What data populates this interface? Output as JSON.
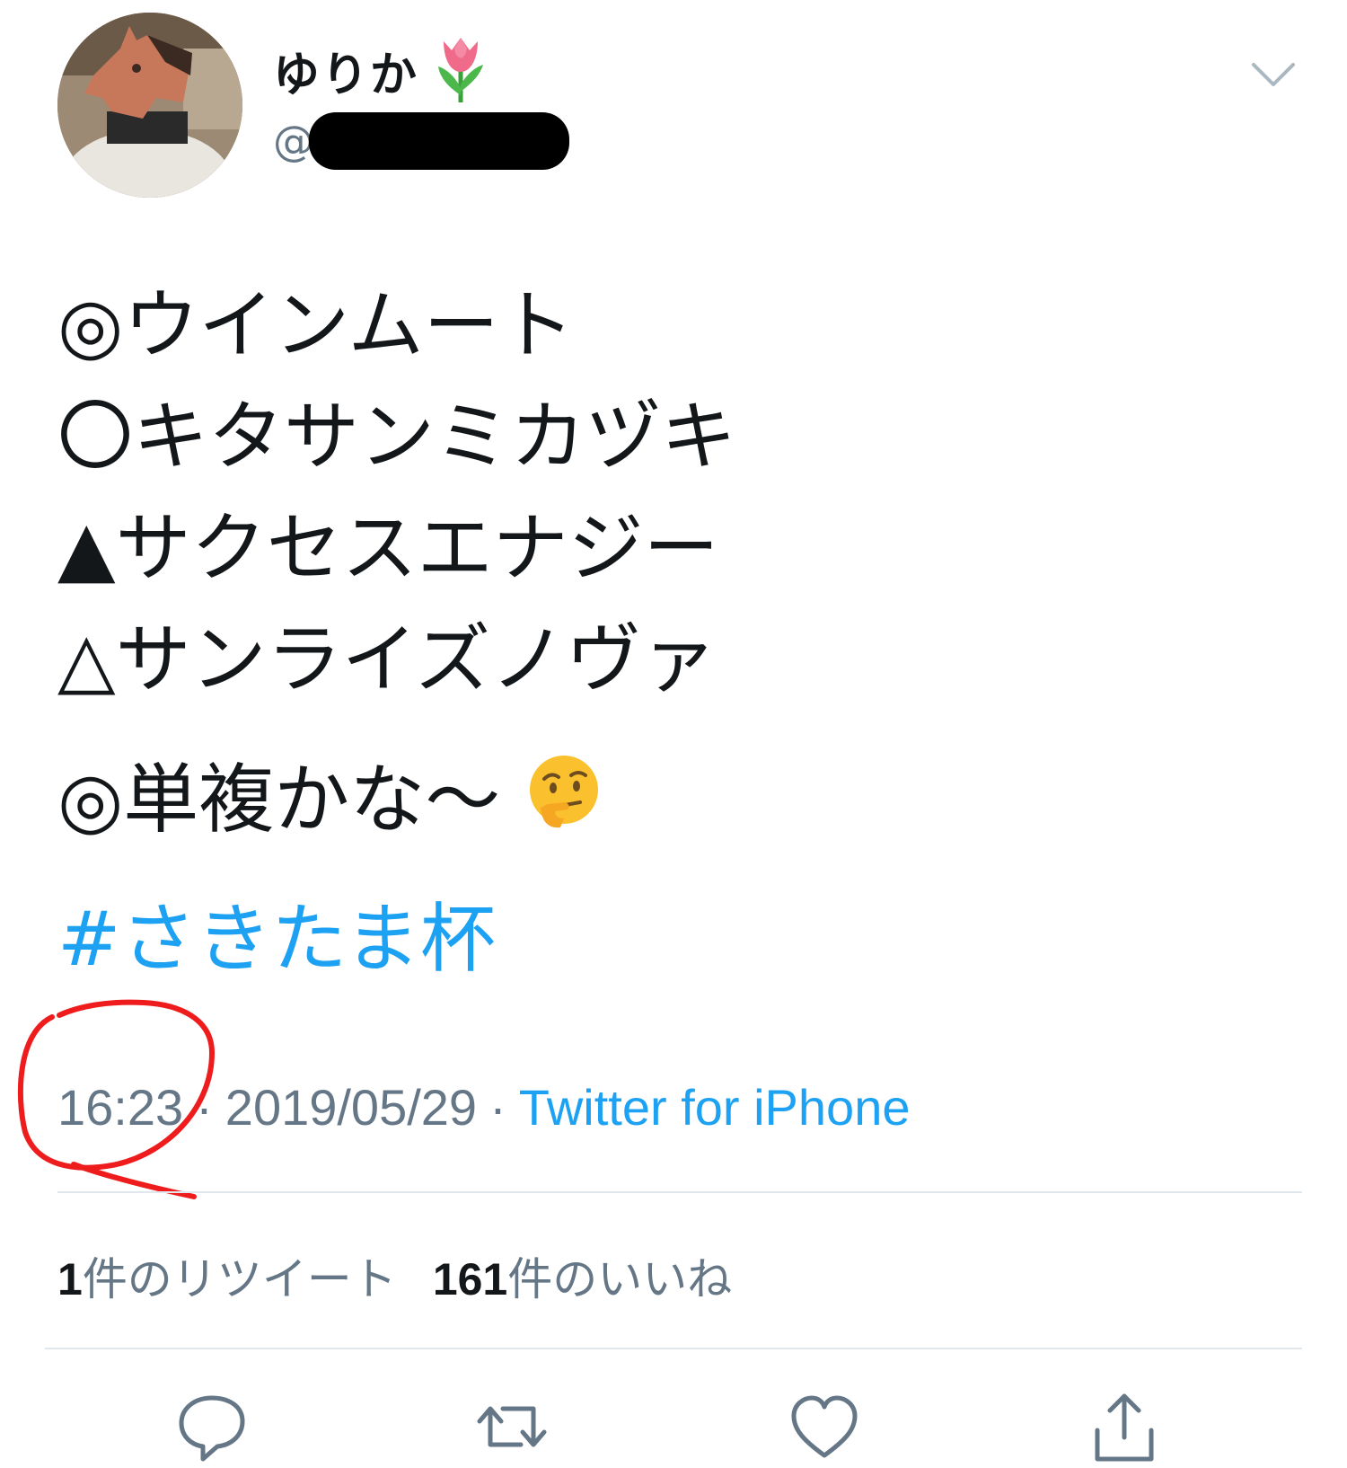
{
  "user": {
    "display_name": "ゆりか",
    "name_emoji_icon": "tulip-icon",
    "handle_prefix": "@",
    "handle_redacted": true,
    "avatar_icon": "user-avatar-horse-mask"
  },
  "tweet": {
    "lines": [
      "◎ウインムート",
      "〇キタサンミカヅキ",
      "▲サクセスエナジー",
      "△サンライズノヴァ"
    ],
    "closing_line": "◎単複かな〜",
    "closing_emoji_icon": "thinking-face-icon",
    "hashtag": "#さきたま杯"
  },
  "meta": {
    "time": "16:23",
    "separator": "·",
    "date": "2019/05/29",
    "source": "Twitter for iPhone"
  },
  "stats": {
    "retweet_count": "1",
    "retweet_label": "件のリツイート",
    "like_count": "161",
    "like_label": "件のいいね"
  },
  "actions": [
    "reply-icon",
    "retweet-icon",
    "like-icon",
    "share-icon"
  ],
  "colors": {
    "link_blue": "#1da1f2",
    "muted_gray": "#657786",
    "text": "#14171a",
    "divider": "#e1e8ed",
    "annotation_red": "#ee1c1c"
  }
}
